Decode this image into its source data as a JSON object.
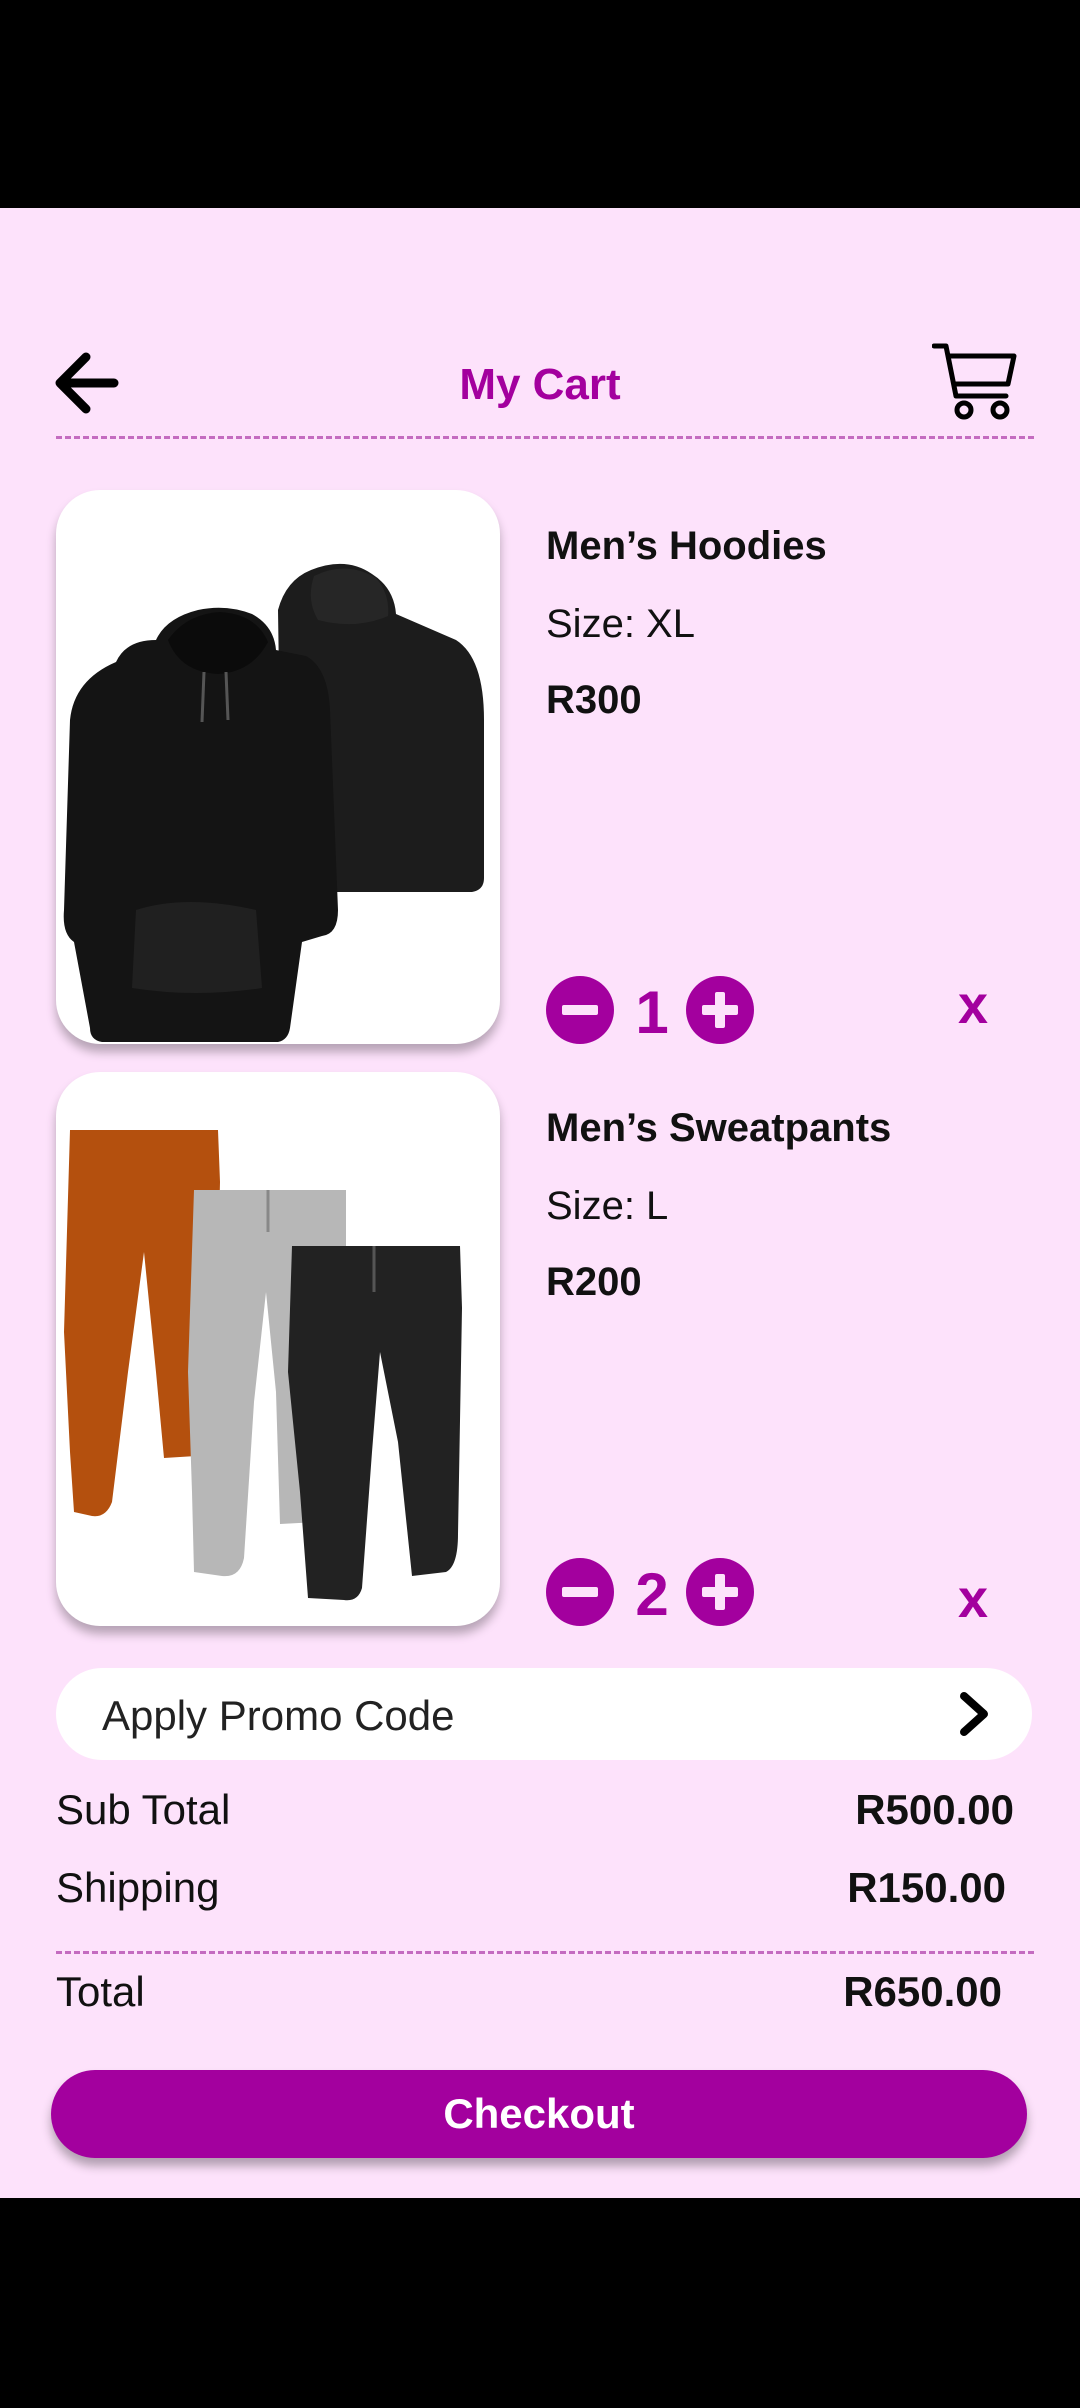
{
  "colors": {
    "accent": "#a3009e",
    "background": "#fde2fb",
    "card": "#ffffff",
    "text": "#111111"
  },
  "header": {
    "title": "My Cart",
    "back_icon": "arrow-left-icon",
    "cart_icon": "shopping-cart-icon"
  },
  "items": [
    {
      "name": "Men’s Hoodies",
      "size": "Size: XL",
      "price": "R300",
      "quantity": "1",
      "remove_label": "x",
      "image": "black-hoodies-image"
    },
    {
      "name": "Men’s Sweatpants",
      "size": "Size: L",
      "price": "R200",
      "quantity": "2",
      "remove_label": "x",
      "image": "sweatpants-image"
    }
  ],
  "promo": {
    "label": "Apply Promo Code",
    "icon": "chevron-right-icon"
  },
  "summary": {
    "subtotal_label": "Sub Total",
    "subtotal_value": "R500.00",
    "shipping_label": "Shipping",
    "shipping_value": "R150.00",
    "total_label": "Total",
    "total_value": "R650.00"
  },
  "checkout_label": "Checkout"
}
